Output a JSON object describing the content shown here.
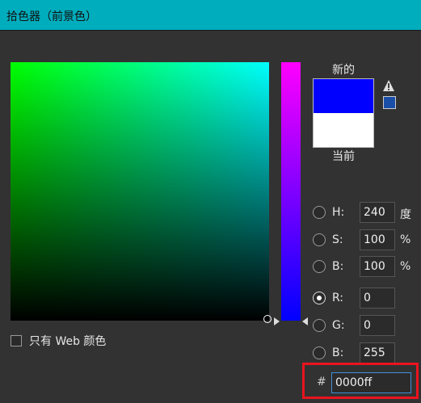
{
  "window": {
    "title": "拾色器（前景色）"
  },
  "preview": {
    "new_label": "新的",
    "current_label": "当前",
    "new_color": "#0000ff",
    "current_color": "#ffffff",
    "warning_icon": "out-of-gamut-warning-icon",
    "websafe_color": "#1a4fa8"
  },
  "hsb": [
    {
      "label": "H:",
      "value": "240",
      "unit": "度",
      "checked": false
    },
    {
      "label": "S:",
      "value": "100",
      "unit": "%",
      "checked": false
    },
    {
      "label": "B:",
      "value": "100",
      "unit": "%",
      "checked": false
    }
  ],
  "rgb": [
    {
      "label": "R:",
      "value": "0",
      "checked": true
    },
    {
      "label": "G:",
      "value": "0",
      "checked": false
    },
    {
      "label": "B:",
      "value": "255",
      "checked": false
    }
  ],
  "websafe": {
    "label": "只有 Web 颜色",
    "checked": false
  },
  "hex": {
    "prefix": "#",
    "value": "0000ff"
  },
  "colors": {
    "titlebar": "#00adbd",
    "highlight": "#e8141e",
    "panel": "#323232"
  }
}
